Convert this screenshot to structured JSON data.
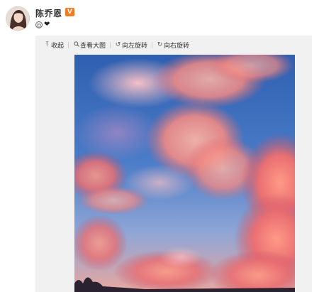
{
  "post": {
    "username": "陈乔恩",
    "verified_badge": "V",
    "emoji_face": "☺",
    "emoji_heart": "❤"
  },
  "toolbar": {
    "collapse_label": "收起",
    "view_large_label": "查看大图",
    "rotate_left_label": "向左旋转",
    "rotate_right_label": "向右旋转"
  },
  "icons": {
    "collapse": "arrow-up-icon",
    "view_large": "magnifier-icon",
    "rotate_left": "rotate-left-icon",
    "rotate_right": "rotate-right-icon"
  },
  "colors": {
    "verified": "#f37a22",
    "panel_bg": "#f1f1f1",
    "sky_blue": "#3a6fbf",
    "cloud_pink": "#f08a86"
  }
}
